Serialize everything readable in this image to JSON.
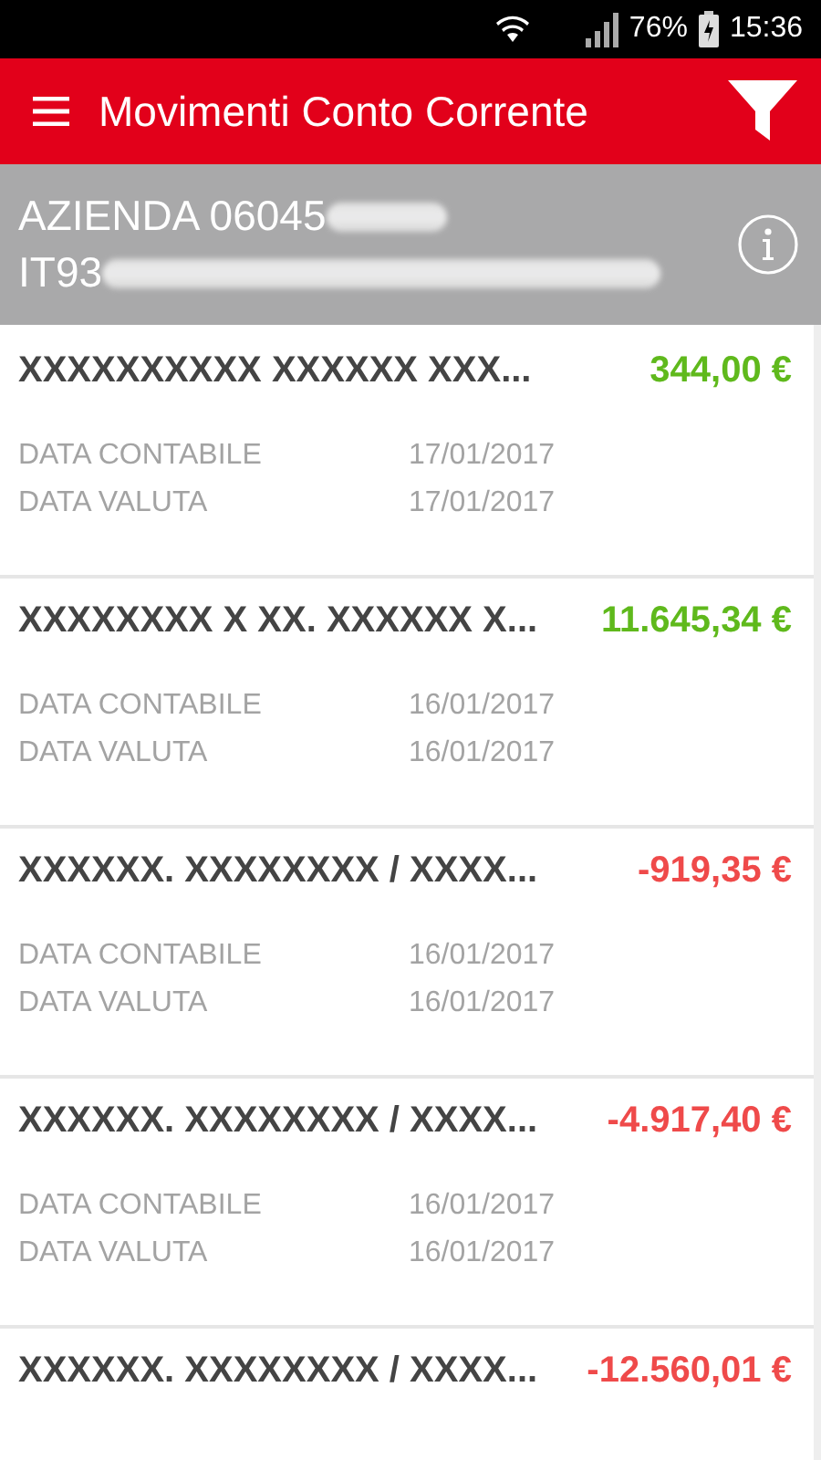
{
  "status_bar": {
    "battery": "76%",
    "time": "15:36"
  },
  "app_bar": {
    "title": "Movimenti Conto Corrente"
  },
  "account": {
    "name": "AZIENDA 06045",
    "iban": "IT93"
  },
  "movements": [
    {
      "description": "XXXXXXXXXX XXXXXX XXX...",
      "amount": "344,00 €",
      "kind": "credit",
      "dates": [
        {
          "label": "DATA CONTABILE",
          "value": "17/01/2017"
        },
        {
          "label": "DATA VALUTA",
          "value": "17/01/2017"
        }
      ]
    },
    {
      "description": "XXXXXXXX X XX. XXXXXX X...",
      "amount": "11.645,34 €",
      "kind": "credit",
      "dates": [
        {
          "label": "DATA CONTABILE",
          "value": "16/01/2017"
        },
        {
          "label": "DATA VALUTA",
          "value": "16/01/2017"
        }
      ]
    },
    {
      "description": "XXXXXX. XXXXXXXX / XXXX...",
      "amount": "-919,35 €",
      "kind": "debit",
      "dates": [
        {
          "label": "DATA CONTABILE",
          "value": "16/01/2017"
        },
        {
          "label": "DATA VALUTA",
          "value": "16/01/2017"
        }
      ]
    },
    {
      "description": "XXXXXX. XXXXXXXX / XXXX...",
      "amount": "-4.917,40 €",
      "kind": "debit",
      "dates": [
        {
          "label": "DATA CONTABILE",
          "value": "16/01/2017"
        },
        {
          "label": "DATA VALUTA",
          "value": "16/01/2017"
        }
      ]
    },
    {
      "description": "XXXXXX. XXXXXXXX / XXXX...",
      "amount": "-12.560,01 €",
      "kind": "debit"
    }
  ]
}
